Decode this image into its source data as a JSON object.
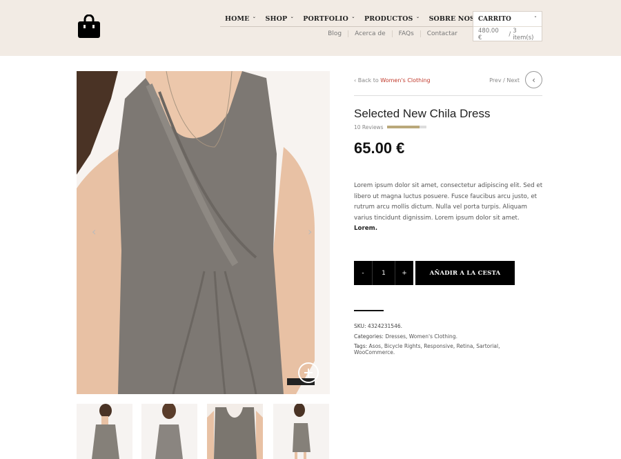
{
  "nav": {
    "items": [
      {
        "label": "HOME"
      },
      {
        "label": "SHOP"
      },
      {
        "label": "PORTFOLIO"
      },
      {
        "label": "PRODUCTOS"
      },
      {
        "label": "SOBRE NOSOTROS"
      }
    ],
    "chevron": "ˇ"
  },
  "subnav": [
    "Blog",
    "Acerca de",
    "FAQs",
    "Contactar"
  ],
  "cart": {
    "title": "CARRITO",
    "total": "480.00 €",
    "separator": "/",
    "items": "3 item(s)"
  },
  "breadcrumb": {
    "prefix": "Back to",
    "link": "Women's Clothing"
  },
  "prevnext": "Prev / Next",
  "product": {
    "title": "Selected New Chila Dress",
    "reviews": "10 Reviews",
    "rating_fraction": 0.82,
    "price": "65.00 €",
    "description": "Lorem ipsum dolor sit amet, consectetur adipiscing elit. Sed et libero ut magna luctus posuere. Fusce faucibus arcu justo, et rutrum arcu mollis dictum. Nulla vel porta turpis. Aliquam varius tincidunt dignissim. Lorem ipsum dolor sit amet.",
    "description_bold": "Lorem.",
    "quantity": "1",
    "minus": "-",
    "plus": "+",
    "add_to_cart": "AÑADIR A LA CESTA"
  },
  "meta": {
    "sku_label": "SKU:",
    "sku": "4324231546.",
    "categories_label": "Categories:",
    "categories": [
      "Dresses",
      "Women's Clothing."
    ],
    "tags_label": "Tags:",
    "tags": [
      "Asos",
      "Bicycle Rights",
      "Responsive",
      "Retina",
      "Sartorial",
      "WooCommerce."
    ]
  },
  "colors": {
    "header_bg": "#f2ebe4",
    "accent_link": "#c0392b",
    "button_bg": "#000000",
    "dress_gray": "#7d7873",
    "skin": "#e8c1a4"
  },
  "icons": {
    "logo": "shopping-bag-icon",
    "prev": "chevron-left-circle-icon",
    "zoom": "plus-circle-icon",
    "slider_prev": "chevron-left-icon",
    "slider_next": "chevron-right-icon"
  }
}
